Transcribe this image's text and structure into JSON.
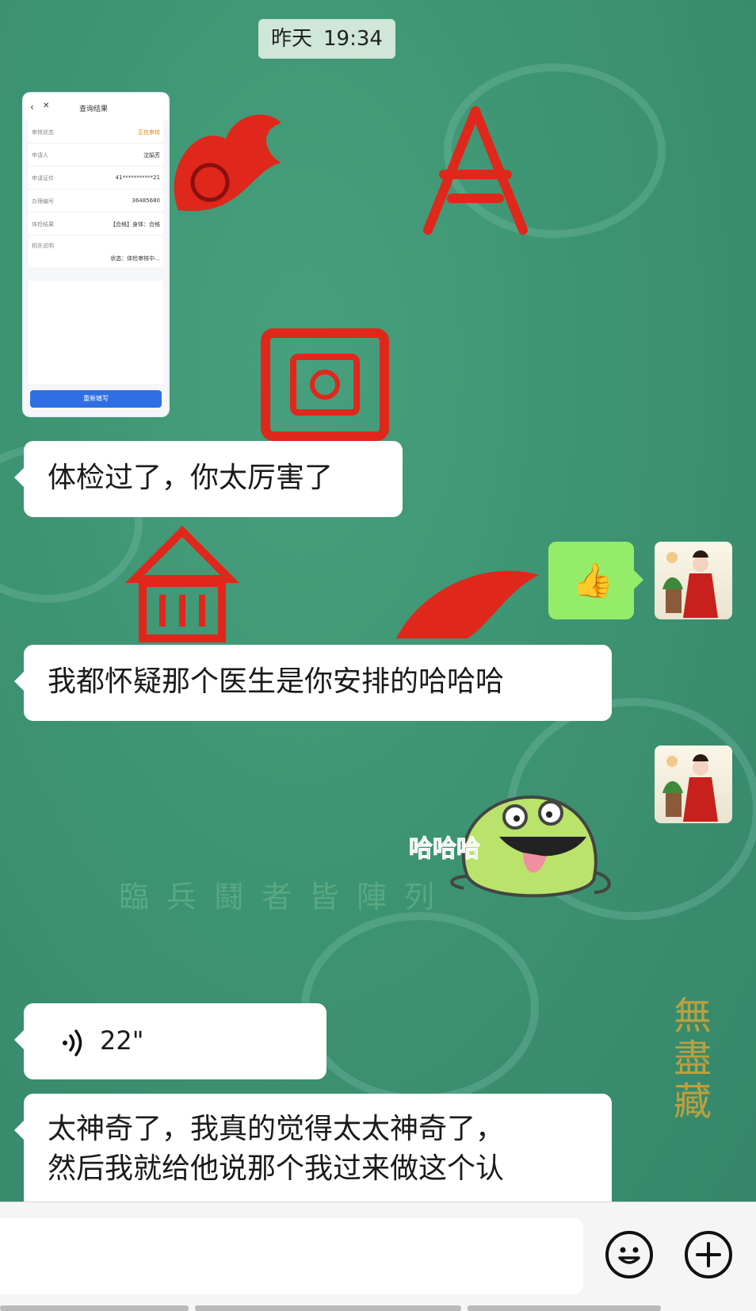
{
  "header": {
    "day": "昨天",
    "time": "19:34"
  },
  "screenshot_card": {
    "title": "查询结果",
    "rows": [
      {
        "label": "审核状态",
        "value": "正在审核"
      },
      {
        "label": "申请人",
        "value": "沈娟芳"
      },
      {
        "label": "申请证件",
        "value": "41***********21"
      },
      {
        "label": "办理编号",
        "value": "36485680"
      },
      {
        "label": "体检结果",
        "value": "【合格】身体：合格"
      },
      {
        "label": "相关说明",
        "value": "状态：体检审核中..."
      }
    ],
    "button": "重新填写"
  },
  "messages": [
    {
      "side": "left",
      "type": "text",
      "text": "体检过了，你太厉害了"
    },
    {
      "side": "right",
      "type": "emoji",
      "emoji": "👍",
      "icon": "thumbs-up-icon"
    },
    {
      "side": "left",
      "type": "text",
      "text": "我都怀疑那个医生是你安排的哈哈哈"
    },
    {
      "side": "right",
      "type": "sticker",
      "sticker_text": "哈哈哈"
    },
    {
      "side": "left",
      "type": "voice",
      "duration": "22\""
    },
    {
      "side": "left",
      "type": "text",
      "line1": "太神奇了，我真的觉得太太神奇了，",
      "line2": "然后我就给他说那个我过来做这个认"
    }
  ],
  "background": {
    "row_text": "臨兵鬪者皆陣列",
    "vertical_text": "無盡藏",
    "primary_color": "#3d9472",
    "accent_red": "#e0271b",
    "accent_gold": "#c9a33b"
  },
  "toolbar": {
    "emoji_icon": "smile-icon",
    "plus_icon": "plus-icon"
  }
}
